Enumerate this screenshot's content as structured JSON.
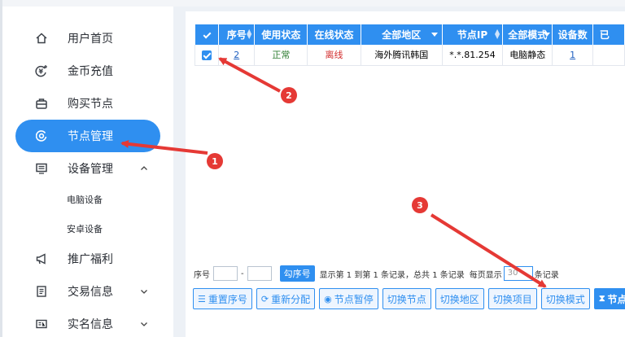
{
  "sidebar": {
    "items": [
      {
        "label": "用户首页",
        "icon": "home-icon"
      },
      {
        "label": "金币充值",
        "icon": "coin-icon"
      },
      {
        "label": "购买节点",
        "icon": "bag-icon"
      },
      {
        "label": "节点管理",
        "icon": "target-icon",
        "active": true
      },
      {
        "label": "设备管理",
        "icon": "monitor-icon",
        "chevron": "up"
      },
      {
        "label": "推广福利",
        "icon": "megaphone-icon"
      },
      {
        "label": "交易信息",
        "icon": "document-icon",
        "chevron": "down"
      },
      {
        "label": "实名信息",
        "icon": "id-card-icon",
        "chevron": "down"
      }
    ],
    "sub_items": [
      "电脑设备",
      "安卓设备"
    ]
  },
  "table": {
    "headers": [
      "序号",
      "使用状态",
      "在线状态",
      "全部地区",
      "节点IP",
      "全部模式",
      "设备数",
      "已"
    ],
    "rows": [
      {
        "checked": true,
        "index": "2",
        "use_status": "正常",
        "online_status": "离线",
        "region": "海外腾讯韩国",
        "ip": "*.*.81.254",
        "mode": "电脑静态",
        "device_count": "1",
        "extra": ""
      }
    ]
  },
  "pager": {
    "seq_label": "序号",
    "dash": "-",
    "check_button": "勾序号",
    "summary": "显示第 1 到第 1 条记录，总共 1 条记录",
    "per_page_label": "每页显示",
    "per_page_value": "30",
    "records_suffix": "条记录"
  },
  "toolbar": {
    "buttons": [
      {
        "label": "重置序号",
        "icon": "list-icon"
      },
      {
        "label": "重新分配",
        "icon": "refresh-icon"
      },
      {
        "label": "节点暂停",
        "icon": "pause-circle-icon"
      },
      {
        "label": "切换节点",
        "icon": ""
      },
      {
        "label": "切换地区",
        "icon": ""
      },
      {
        "label": "切换项目",
        "icon": ""
      },
      {
        "label": "切换模式",
        "icon": ""
      },
      {
        "label": "节点",
        "icon": "hourglass-icon",
        "primary": true
      }
    ]
  },
  "annotations": [
    "1",
    "2",
    "3"
  ],
  "colors": {
    "accent": "#2f8ff0",
    "arrow": "#e53935",
    "ok": "#2e7d32",
    "offline": "#d32f2f"
  }
}
